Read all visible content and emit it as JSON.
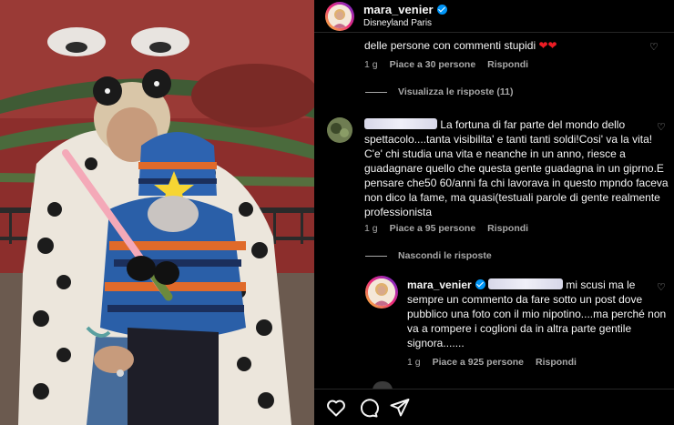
{
  "header": {
    "username": "mara_venier",
    "location": "Disneyland Paris"
  },
  "comments": [
    {
      "text": "delle persone con commenti stupidi",
      "emoji": "❤❤",
      "age": "1 g",
      "likes": "Piace a 30 persone",
      "reply": "Rispondi"
    },
    {
      "toggle": "Visualizza le risposte (11)"
    },
    {
      "text": "La fortuna di far parte del mondo dello spettacolo....tanta visibilita' e tanti tanti soldi!Cosi' va la vita! C'e' chi studia una vita e neanche in un anno, riesce a guadagnare quello che questa gente guadagna in un giprno.E pensare che50 60/anni fa chi lavorava in questo mpndo faceva non dico la fame, ma quasi(testuali parole di gente realmente professionista",
      "age": "1 g",
      "likes": "Piace a 95 persone",
      "reply": "Rispondi"
    },
    {
      "toggle": "Nascondi le risposte"
    },
    {
      "username": "mara_venier",
      "text": "mi scusi ma le sempre un commento da fare sotto un post dove pubblico una foto con il mio nipotino....ma perché non va a rompere i coglioni da in altra parte gentile signora.......",
      "age": "1 g",
      "likes": "Piace a 925 persone",
      "reply": "Rispondi"
    }
  ],
  "actions": {
    "like_icon": "heart-outline-icon",
    "comment_icon": "speech-bubble-icon",
    "share_icon": "paper-plane-icon"
  },
  "colors": {
    "background": "#000000",
    "text": "#f5f5f5",
    "secondary": "#a8a8a8",
    "verified": "#0095f6",
    "heart": "#ed1c24"
  }
}
